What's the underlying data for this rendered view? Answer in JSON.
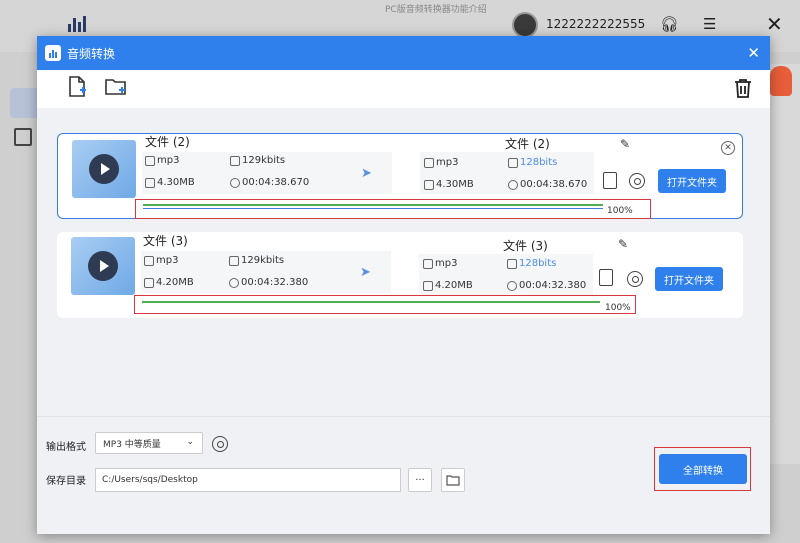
{
  "background": {
    "user_name": "1222222222555",
    "blur_text": "PC版音频转换器功能介绍"
  },
  "dialog": {
    "title": "音频转换",
    "close_label": "✕"
  },
  "files": [
    {
      "name": "文件 (2)",
      "format": "mp3",
      "bitrate": "129kbits",
      "size": "4.30MB",
      "duration": "00:04:38.670",
      "out_name": "文件 (2)",
      "out_format": "mp3",
      "out_bitrate": "128bits",
      "out_size": "4.30MB",
      "out_duration": "00:04:38.670",
      "progress_percent": 100,
      "progress_label": "100%",
      "open_folder": "打开文件夹"
    },
    {
      "name": "文件 (3)",
      "format": "mp3",
      "bitrate": "129kbits",
      "size": "4.20MB",
      "duration": "00:04:32.380",
      "out_name": "文件 (3)",
      "out_format": "mp3",
      "out_bitrate": "128bits",
      "out_size": "4.20MB",
      "out_duration": "00:04:32.380",
      "progress_percent": 100,
      "progress_label": "100%",
      "open_folder": "打开文件夹"
    }
  ],
  "bottom": {
    "format_label": "输出格式",
    "format_value": "MP3 中等质量",
    "save_label": "保存目录",
    "save_path": "C:/Users/sqs/Desktop",
    "more_label": "···",
    "convert_all": "全部转换"
  },
  "colors": {
    "accent": "#2f80ed",
    "highlight": "#d9363e",
    "progress_green": "#4caf50",
    "progress_blue": "#3b7be0"
  }
}
